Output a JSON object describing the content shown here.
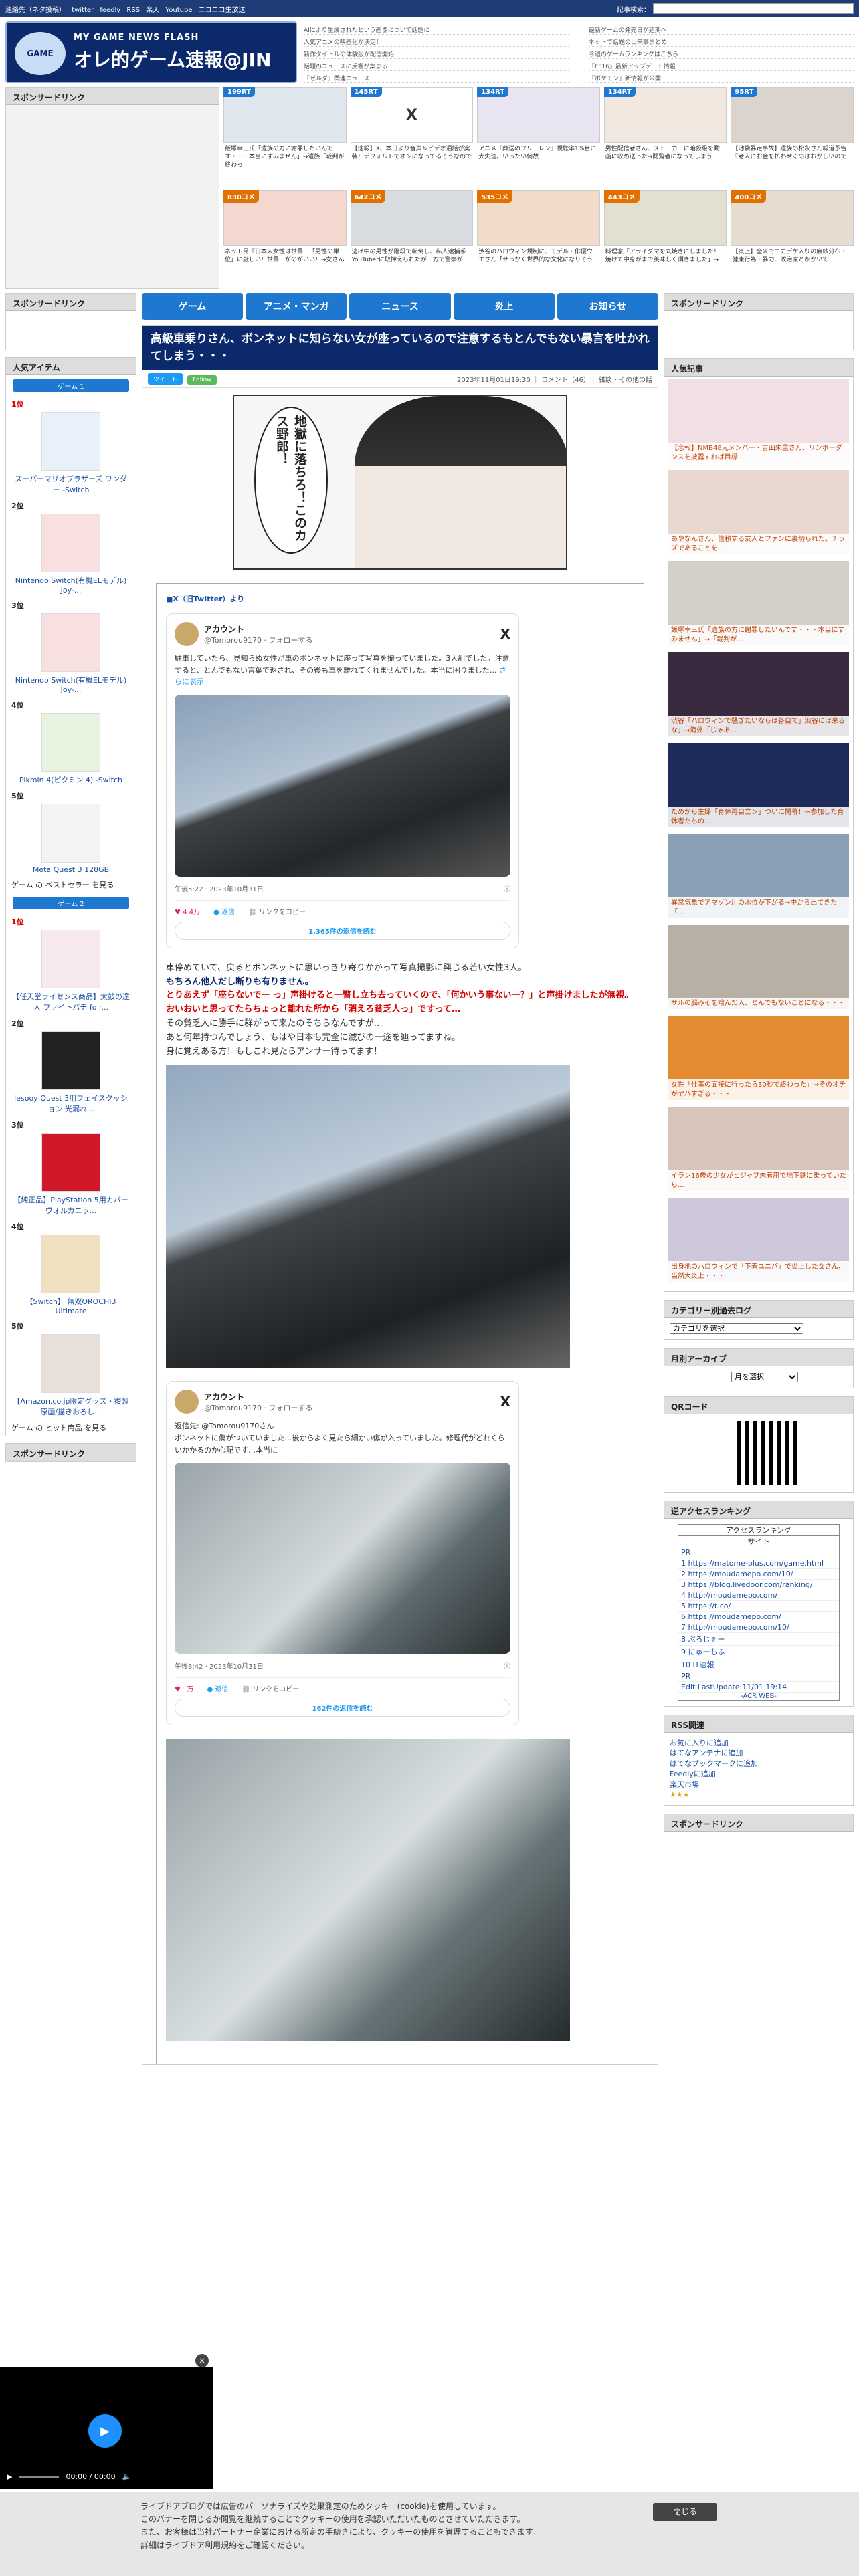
{
  "topbar": {
    "links": [
      "連絡先（ネタ投稿）",
      "twitter",
      "feedly",
      "RSS",
      "楽天",
      "Youtube",
      "ニコニコ生放送"
    ],
    "search_label": "記事検索："
  },
  "site": {
    "logo_small": "MY GAME NEWS FLASH",
    "logo_title": "オレ的ゲーム速報@JIN",
    "mascot": "GAME"
  },
  "headlines": [
    "AIにより生成されたという画像について話題に",
    "最新ゲームの発売日が延期へ",
    "人気アニメの映画化が決定！",
    "ネットで話題の出来事まとめ",
    "新作タイトルの体験版が配信開始",
    "今週のゲームランキングはこちら",
    "話題のニュースに反響が集まる",
    "『FF16』最新アップデート情報",
    "『ゼルダ』関連ニュース",
    "『ポケモン』新情報が公開"
  ],
  "sponsored_label": "スポンサードリンク",
  "thumbs": [
    {
      "badge": "199RT",
      "badge_color": "#1e78d0",
      "pic": "",
      "caption": "飯塚幸三氏「遺族の方に謝罪したいんです・・・本当にすみません」→遺族「裁判が終わっ"
    },
    {
      "badge": "145RT",
      "badge_color": "#1e78d0",
      "pic": "X",
      "caption": "【速報】X、本日より音声＆ビデオ通話が実装！デフォルトでオンになってるそうなので"
    },
    {
      "badge": "134RT",
      "badge_color": "#1e78d0",
      "pic": "",
      "caption": "アニメ『葬送のフリーレン』視聴率1%台に大失速。いったい何故"
    },
    {
      "badge": "134RT",
      "badge_color": "#1e78d0",
      "pic": "",
      "caption": "男性配信者さん、ストーカーに暗殺級を動画に収め送った→閲覧者になってしまう"
    },
    {
      "badge": "95RT",
      "badge_color": "#1e78d0",
      "pic": "",
      "caption": "【池袋暴走事故】遺族の松永さん報道予告『老人にお金を払わせるのはおかしいので"
    },
    {
      "badge": "830コメ",
      "badge_color": "#e07000",
      "pic": "",
      "caption": "ネット民『日本人女性は世界一「男性の単位」に厳しい！世界一がのがいい！→女さん"
    },
    {
      "badge": "642コメ",
      "badge_color": "#e07000",
      "pic": "",
      "caption": "逃げ中の男性が階段で転倒し、私人逮捕系YouTuberに取押えられたが一方で警察が"
    },
    {
      "badge": "535コメ",
      "badge_color": "#e07000",
      "pic": "",
      "caption": "渋谷のハロウィン規制に、モデル・俳優ウエさん「せっかく世界的な文化になりそう"
    },
    {
      "badge": "443コメ",
      "badge_color": "#e07000",
      "pic": "",
      "caption": "料理家「アライグマを丸焼きにしました！焼けて中身がまで美味しく頂きました」→"
    },
    {
      "badge": "400コメ",
      "badge_color": "#e07000",
      "pic": "",
      "caption": "【炎上】全米でコカデケ入りの麻紗分布・健康行為・暴力、政治家とかかいて"
    }
  ],
  "nav": [
    "ゲーム",
    "アニメ・マンガ",
    "ニュース",
    "炎上",
    "お知らせ"
  ],
  "left": {
    "popular_title": "人気アイテム",
    "group1": "ゲーム 1",
    "group2": "ゲーム 2",
    "items1": [
      {
        "rank": "1位",
        "name": "スーパーマリオブラザーズ ワンダー -Switch"
      },
      {
        "rank": "2位",
        "name": "Nintendo Switch(有機ELモデル) Joy-..."
      },
      {
        "rank": "3位",
        "name": "Nintendo Switch(有機ELモデル) Joy-..."
      },
      {
        "rank": "4位",
        "name": "Pikmin 4(ピクミン 4) -Switch"
      },
      {
        "rank": "5位",
        "name": "Meta Quest 3 128GB"
      }
    ],
    "more1": "ゲーム の ベストセラー を見る",
    "items2": [
      {
        "rank": "1位",
        "name": "【任天堂ライセンス商品】太鼓の達人 ファイトバチ fo r..."
      },
      {
        "rank": "2位",
        "name": "lesooy Quest 3用フェイスクッション 光漏れ..."
      },
      {
        "rank": "3位",
        "name": "【純正品】PlayStation 5用カバー ヴォルカニッ..."
      },
      {
        "rank": "4位",
        "name": "【Switch】 無双OROCHI3 Ultimate"
      },
      {
        "rank": "5位",
        "name": "【Amazon.co.jp限定グッズ・複製原画/描きおろし..."
      }
    ],
    "more2": "ゲーム の ヒット商品 を見る",
    "sponsored_bottom": "スポンサードリンク"
  },
  "article": {
    "title": "高級車乗りさん、ボンネットに知らない女が座っているので注意するもとんでもない暴言を吐かれてしまう・・・",
    "tweet_btn": "ツイート",
    "follow_btn": "Follow",
    "meta": "2023年11月01日19:30 ｜ コメント（46）｜ 雑談・その他の話",
    "manga_text": "地獄に落ちろ！このカス野郎！",
    "source": "■X（旧Twitter）より",
    "tweet1": {
      "name": "アカウント",
      "handle": "@Tomorou9170 · フォローする",
      "text": "駐車していたら、見知らぬ女性が車のボンネットに座って写真を撮っていました。3人組でした。注意すると、とんでもない言葉で返され、その後も車を離れてくれませんでした。本当に困りました… ",
      "more_link": "さらに表示",
      "time": "午後5:22 · 2023年10月31日",
      "likes": "4.4万",
      "reply": "返信",
      "share": "リンクをコピー",
      "readmore": "1,365件の返信を読む"
    },
    "p1": "車停めていて、戻るとボンネットに思いっきり寄りかかって写真撮影に興じる若い女性3人。",
    "p2": "もちろん他人だし断りも有りません。",
    "p3": "とりあえず「座らないでー っ」声掛けると一瞥し立ち去っていくので、「何かいう事ない一？」と声掛けましたが無視。おいおいと思ってたらちょっと離れた所から「消えろ貧乏人っ」ですって…",
    "p4": "その貧乏人に勝手に群がって来たのそちらなんですが…",
    "p5": "あと何年持つんでしょう、もはや日本も完全に滅びの一途を辿ってますね。",
    "p6": "身に覚えある方！もしこれ見たらアンサー待ってます！",
    "tweet2": {
      "name": "アカウント",
      "handle": "@Tomorou9170 · フォローする",
      "reply_to": "返信先: @Tomorou9170さん",
      "text": "ボンネットに傷がついていました…後からよく見たら細かい傷が入っていました。修理代がどれくらいかかるのか心配です…本当に",
      "time": "午後8:42 · 2023年10月31日",
      "likes": "1万",
      "reply": "返信",
      "share": "リンクをコピー",
      "readmore": "162件の返信を読む"
    }
  },
  "right": {
    "sponsored": "スポンサードリンク",
    "kiji_title": "人気記事",
    "kiji": [
      "【悲報】NMB48元メンバー・吉田朱里さん、リンボーダンスを披露すれば目標...",
      "あやなんさん、信頼する友人とファンに裏切られた。チラズであることを...",
      "飯塚幸三氏「遺族の方に謝罪したいんです・・・本当にすみません」→「裁判が...",
      "渋谷「ハロウィンで騒ぎたいならは各自で」渋谷には来るな」→海外「じゃあ...",
      "ためから主婦「育休再自立ン」ついに開幕！→参加した育休者たちの...",
      "異常気象でアマゾン川の水位が下がる→中から出てきた「...",
      "サルの脳みそを喰んだ人、とんでもないことになる・・・",
      "女性「仕事の面接に行ったら30秒で終わった」→そのオチがヤバすぎる・・・",
      "イラン16歳の少女がヒジャブ未着用で地下鉄に乗っていたら...",
      "出身地のハロウィンで「下着ユニバ」で炎上した女さん、当然大炎上・・・"
    ],
    "cat_title": "カテゴリー別過去ログ",
    "cat_select": "カテゴリを選択",
    "month_title": "月別アーカイブ",
    "month_select": "月を選択",
    "qr_title": "QRコード",
    "acr_title": "逆アクセスランキング",
    "acr_head": "アクセスランキング",
    "acr_site": "サイト",
    "acr_rows": [
      "1 https://matome-plus.com/game.html",
      "2 https://moudamepo.com/10/",
      "3 https://blog.livedoor.com/ranking/",
      "4 http://moudamepo.com/",
      "5 https://t.co/",
      "6 https://moudamepo.com/",
      "7 http://moudamepo.com/10/",
      "8 ぷろじぇー",
      "9 にゅーもふ",
      "10 IT速報"
    ],
    "acr_pr": "PR",
    "acr_footer": "Edit LastUpdate:11/01 19:14",
    "acr_web": "-ACR WEB-",
    "rss_title": "RSS関連",
    "rss": [
      "お気に入りに追加",
      "はてなアンテナに追加",
      "はてなブックマークに追加",
      "Feedlyに追加",
      "楽天市場"
    ],
    "sponsored2": "スポンサードリンク"
  },
  "player": {
    "time": "00:00 / 00:00",
    "close": "×"
  },
  "cookie": {
    "line1": "ライブドアブログでは広告のパーソナライズや効果測定のためクッキー(cookie)を使用しています。",
    "line2": "このバナーを閉じるか閲覧を継続することでクッキーの使用を承認いただいたものとさせていただきます。",
    "line3": "また、お客様は当社パートナー企業における所定の手続きにより、クッキーの使用を管理することもできます。",
    "line4": "詳細はライブドア利用規約をご確認ください。",
    "close": "閉じる"
  }
}
